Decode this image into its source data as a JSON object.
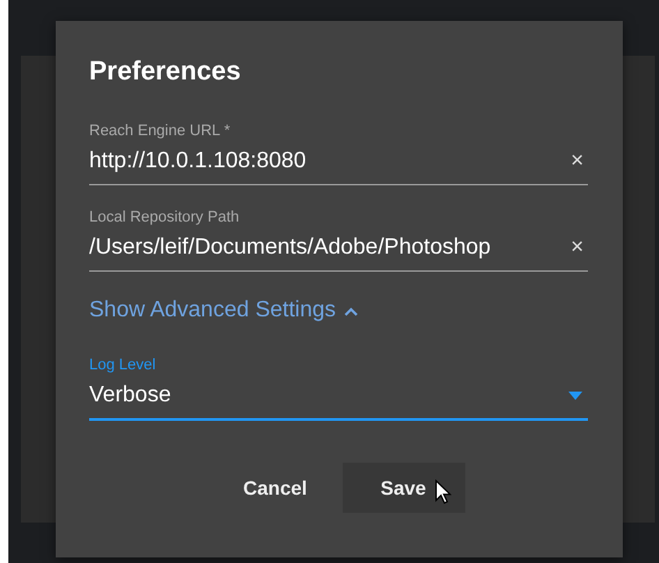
{
  "dialog": {
    "title": "Preferences"
  },
  "fields": [
    {
      "kind": "text",
      "label": "Reach Engine URL *",
      "value": "http://10.0.1.108:8080",
      "clear": "×",
      "focused": false
    },
    {
      "kind": "text",
      "label": "Local Repository Path",
      "value": "/Users/leif/Documents/Adobe/Photoshop",
      "clear": "×",
      "focused": false
    }
  ],
  "advanced": {
    "label": "Show Advanced Settings",
    "expanded": true
  },
  "advanced_fields": [
    {
      "kind": "select",
      "label": "Log Level",
      "value": "Verbose",
      "focused": true
    }
  ],
  "buttons": [
    {
      "label": "Cancel",
      "hovered": false
    },
    {
      "label": "Save",
      "hovered": true
    }
  ]
}
